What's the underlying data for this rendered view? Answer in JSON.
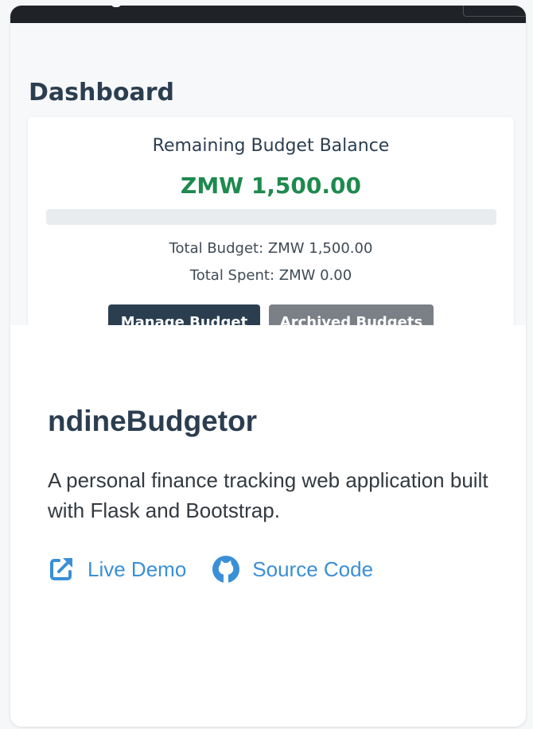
{
  "preview": {
    "dashboard_title": "Dashboard",
    "balance_label": "Remaining Budget Balance",
    "balance_amount": "ZMW 1,500.00",
    "spent_progress_percent": 0,
    "total_budget": "Total Budget: ZMW 1,500.00",
    "total_spent": "Total Spent: ZMW 0.00",
    "manage_button": "Manage Budget",
    "archived_button": "Archived Budgets"
  },
  "project": {
    "title": "ndineBudgetor",
    "description": "A personal finance tracking web application built with Flask and Bootstrap.",
    "links": [
      {
        "label": "Live Demo",
        "icon": "external-link-icon"
      },
      {
        "label": "Source Code",
        "icon": "github-icon"
      }
    ]
  },
  "colors": {
    "accent": "#3a8fd6",
    "balance_green": "#1e8a4e",
    "navy": "#2b3e50",
    "secondary": "#7b8087"
  }
}
